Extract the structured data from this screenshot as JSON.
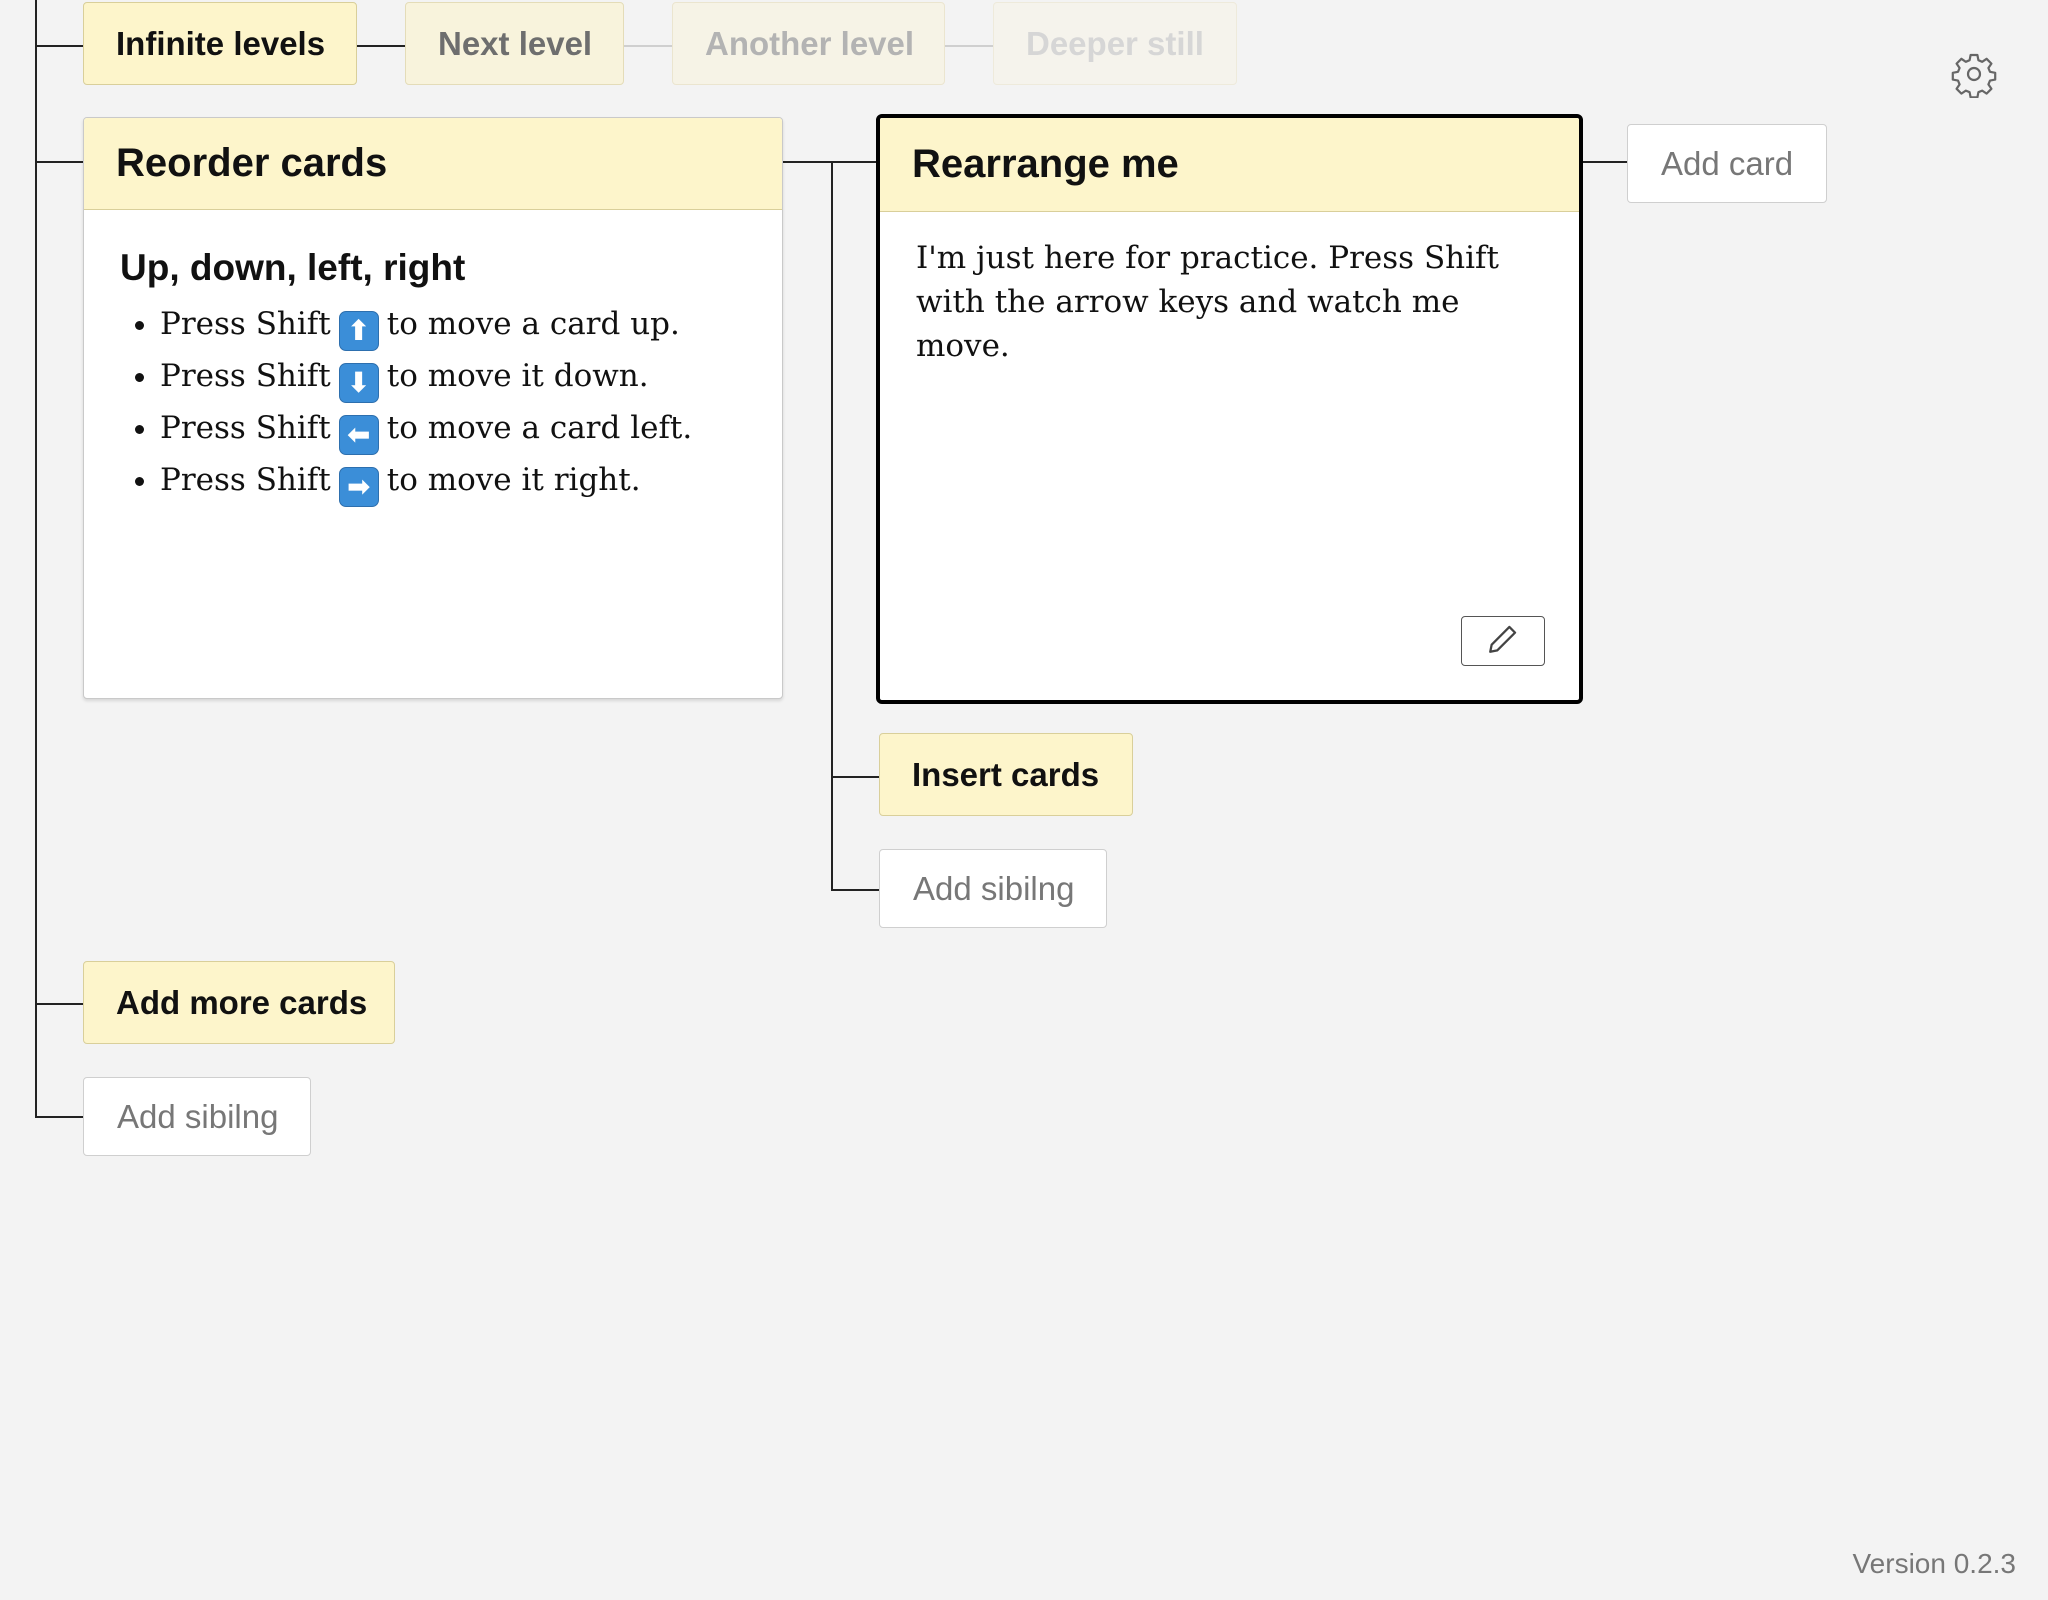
{
  "breadcrumb": {
    "levels": [
      "Infinite levels",
      "Next level",
      "Another level",
      "Deeper still"
    ]
  },
  "cards": {
    "reorder": {
      "title": "Reorder cards",
      "heading": "Up, down, left, right",
      "items": [
        {
          "before": "Press Shift",
          "key": "⬆",
          "after": "to move a card up."
        },
        {
          "before": "Press Shift",
          "key": "⬇",
          "after": "to move it down."
        },
        {
          "before": "Press Shift",
          "key": "⬅",
          "after": "to move a card left."
        },
        {
          "before": "Press Shift",
          "key": "➡",
          "after": "to move it right."
        }
      ]
    },
    "rearrange": {
      "title": "Rearrange me",
      "body": "I'm just here for practice. Press Shift with the arrow keys and watch me move."
    },
    "insert": {
      "title": "Insert cards"
    },
    "add_more": {
      "title": "Add more cards"
    }
  },
  "buttons": {
    "add_card": "Add card",
    "add_sibling_inner": "Add sibilng",
    "add_sibling_outer": "Add sibilng"
  },
  "icons": {
    "settings": "gear-icon",
    "edit": "pencil-icon"
  },
  "footer": {
    "version": "Version 0.2.3"
  }
}
